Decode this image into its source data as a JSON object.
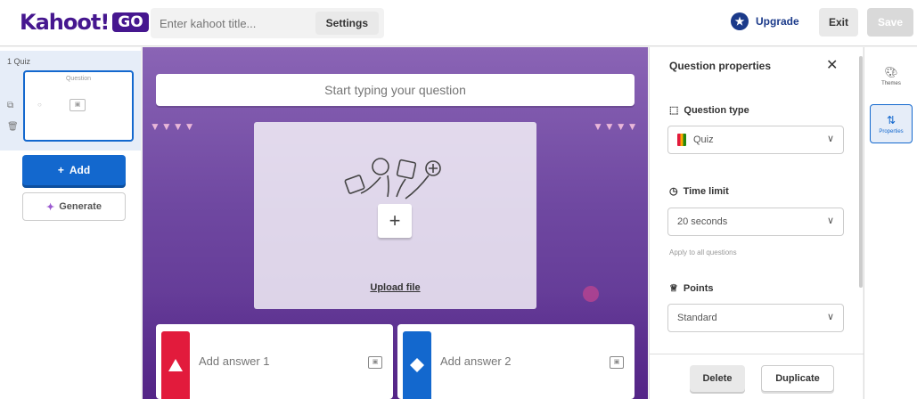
{
  "header": {
    "logo_text": "Kahoot!",
    "logo_badge": "GO",
    "title_placeholder": "Enter kahoot title...",
    "settings_label": "Settings",
    "upgrade_label": "Upgrade",
    "exit_label": "Exit",
    "save_label": "Save"
  },
  "sidebar": {
    "slide_number": "1",
    "slide_type": "Quiz",
    "slide_caption": "Question",
    "add_label": "Add",
    "generate_label": "Generate"
  },
  "editor": {
    "question_placeholder": "Start typing your question",
    "upload_label": "Upload file",
    "answers": [
      {
        "placeholder": "Add answer 1",
        "color": "#e21b3c",
        "shape": "triangle"
      },
      {
        "placeholder": "Add answer 2",
        "color": "#1368ce",
        "shape": "diamond"
      }
    ]
  },
  "properties": {
    "title": "Question properties",
    "question_type_label": "Question type",
    "question_type_value": "Quiz",
    "time_limit_label": "Time limit",
    "time_limit_value": "20 seconds",
    "apply_all_label": "Apply to all questions",
    "points_label": "Points",
    "points_value": "Standard",
    "delete_label": "Delete",
    "duplicate_label": "Duplicate"
  },
  "rail": {
    "themes_label": "Themes",
    "properties_label": "Properties"
  },
  "colors": {
    "brand": "#46178f",
    "accent_blue": "#1368ce",
    "answer_red": "#e21b3c",
    "answer_blue": "#1368ce"
  }
}
